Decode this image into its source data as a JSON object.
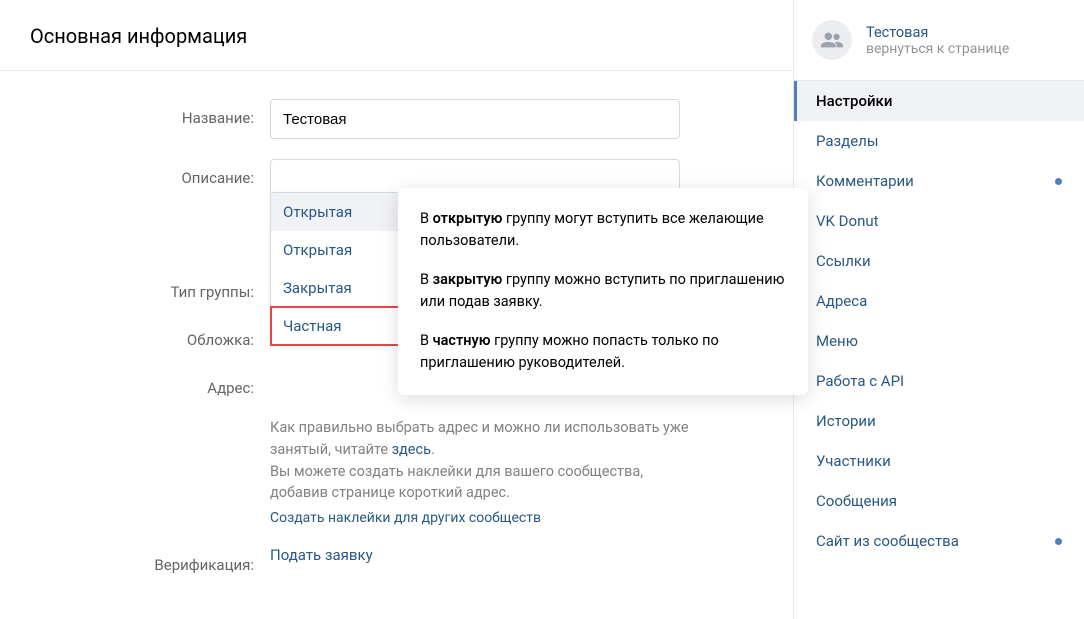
{
  "page": {
    "title": "Основная информация"
  },
  "form": {
    "name_label": "Название:",
    "name_value": "Тестовая",
    "description_label": "Описание:",
    "description_value": "",
    "group_type_label": "Тип группы:",
    "cover_label": "Обложка:",
    "address_label": "Адрес:",
    "verification_label": "Верификация:",
    "verification_link": "Подать заявку",
    "address_help_1": "Как правильно выбрать адрес и можно ли использовать уже занятый, читайте ",
    "address_help_link": "здесь",
    "address_help_1_end": ".",
    "address_help_2": "Вы можете создать наклейки для вашего сообщества, добавив странице короткий адрес.",
    "address_stickers_link": "Создать наклейки для других сообществ"
  },
  "dropdown": {
    "selected": "Открытая",
    "items": [
      "Открытая",
      "Закрытая",
      "Частная"
    ]
  },
  "tooltip": {
    "p1_pre": "В ",
    "p1_bold": "открытую",
    "p1_post": " группу могут вступить все желающие пользователи.",
    "p2_pre": "В ",
    "p2_bold": "закрытую",
    "p2_post": " группу можно вступить по приглашению или подав заявку.",
    "p3_pre": "В ",
    "p3_bold": "частную",
    "p3_post": " группу можно попасть только по приглашению руководителей."
  },
  "sidebar": {
    "group_name": "Тестовая",
    "group_sub": "вернуться к странице",
    "items": [
      {
        "label": "Настройки",
        "active": true
      },
      {
        "label": "Разделы"
      },
      {
        "label": "Комментарии",
        "dot": true
      },
      {
        "label": "VK Donut"
      },
      {
        "label": "Ссылки"
      },
      {
        "label": "Адреса"
      },
      {
        "label": "Меню"
      },
      {
        "label": "Работа с API"
      },
      {
        "label": "Истории"
      },
      {
        "label": "Участники"
      },
      {
        "label": "Сообщения"
      },
      {
        "label": "Сайт из сообщества",
        "dot": true
      }
    ]
  }
}
